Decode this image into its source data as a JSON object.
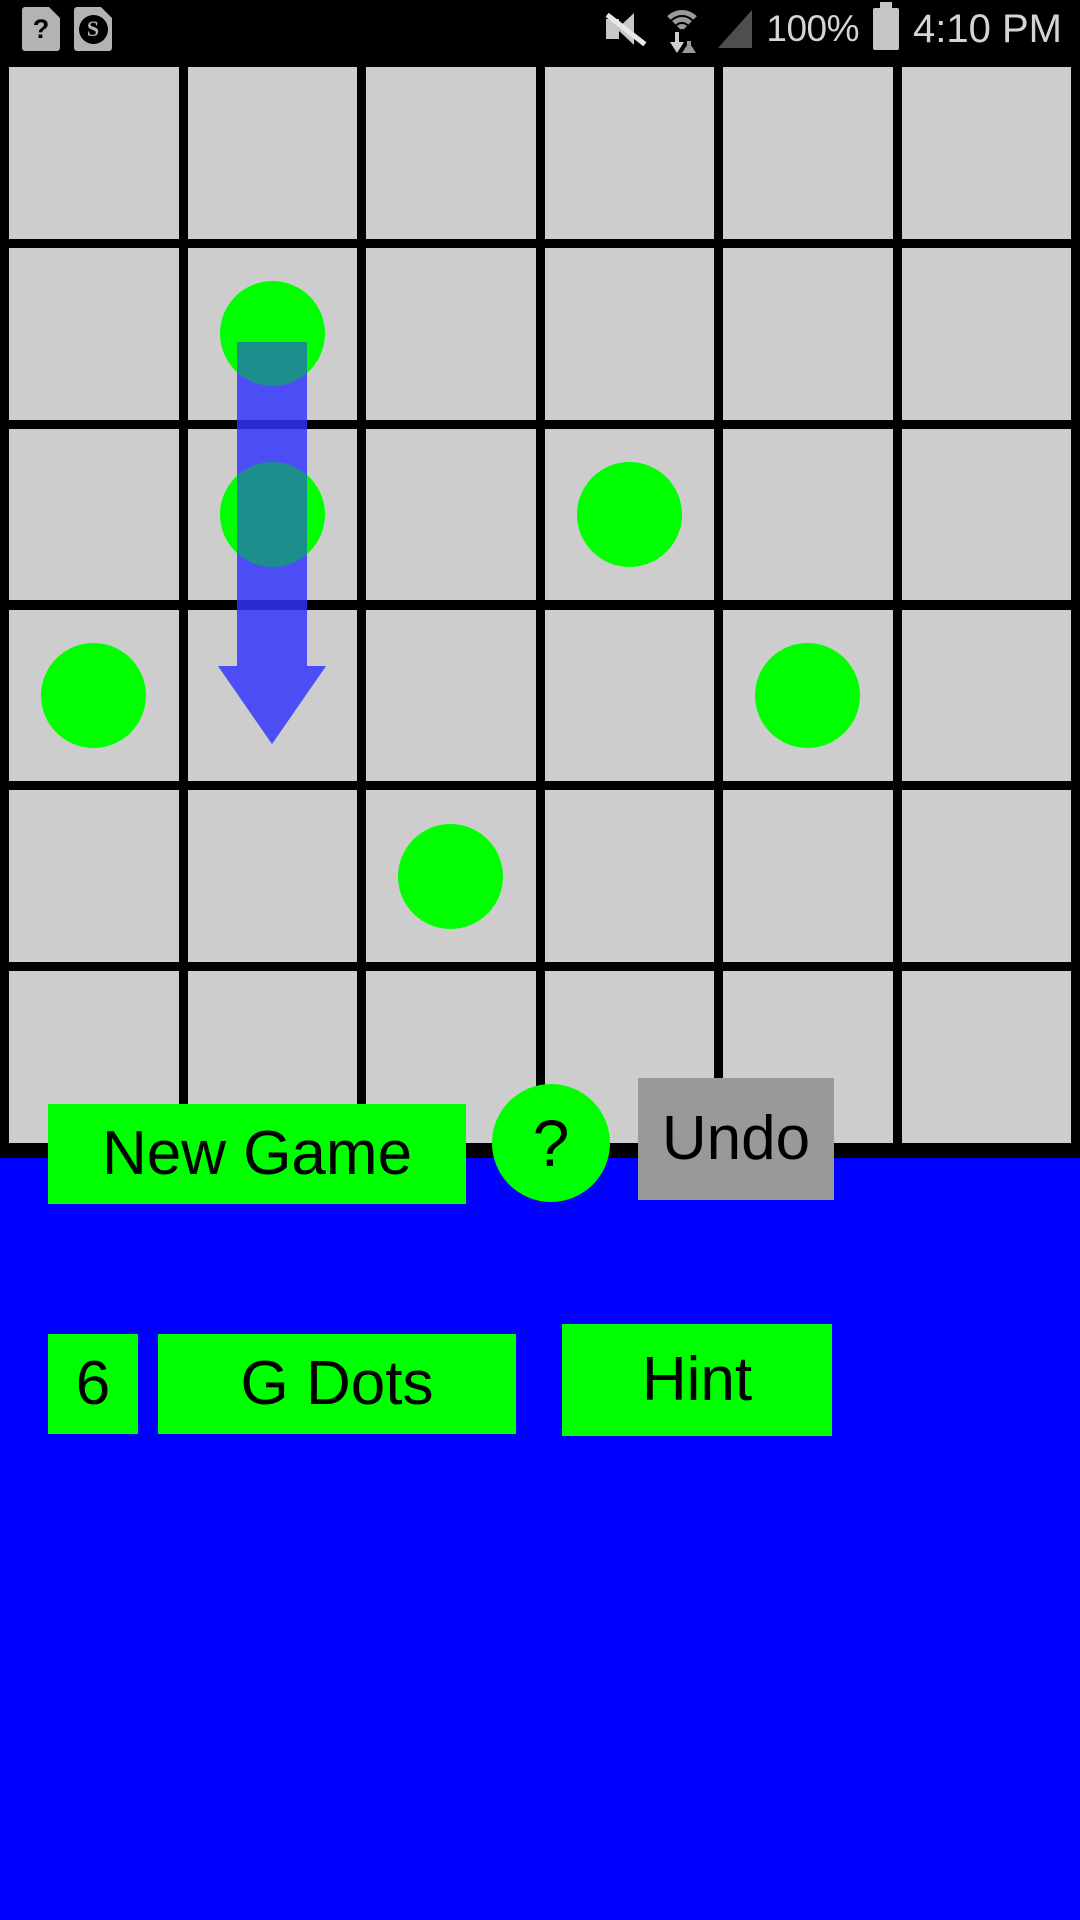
{
  "status_bar": {
    "notifications": [
      {
        "name": "help-doc-icon",
        "glyph": "?"
      },
      {
        "name": "s-doc-icon",
        "glyph": "S"
      }
    ],
    "mute_icon": "volume-mute-icon",
    "wifi_icon": "wifi-transfer-icon",
    "signal_icon": "cell-signal-icon",
    "battery_percent": "100%",
    "battery_icon": "battery-full-icon",
    "time": "4:10 PM"
  },
  "board": {
    "rows": 6,
    "cols": 6,
    "cell_color": "#CDCDCD",
    "grid_line_color": "#000000",
    "dot_color": "#00FF00",
    "arrow_color": "#3333FF",
    "dots": [
      {
        "row": 2,
        "col": 2
      },
      {
        "row": 3,
        "col": 2
      },
      {
        "row": 3,
        "col": 4
      },
      {
        "row": 4,
        "col": 1
      },
      {
        "row": 4,
        "col": 5
      },
      {
        "row": 5,
        "col": 3
      }
    ],
    "move_arrow": {
      "from_row": 2,
      "from_col": 2,
      "to_row": 4,
      "to_col": 2,
      "direction": "down"
    }
  },
  "controls": {
    "new_game_label": "New Game",
    "help_label": "?",
    "undo_label": "Undo",
    "count_label": "6",
    "dots_label": "G Dots",
    "hint_label": "Hint",
    "panel_color": "#0000FF",
    "button_color": "#00FF00",
    "undo_color": "#999999"
  }
}
